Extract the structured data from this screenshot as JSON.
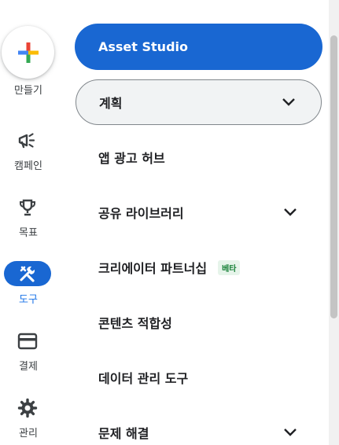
{
  "rail": {
    "create_label": "만들기",
    "items": [
      {
        "label": "캠페인",
        "icon": "megaphone-icon"
      },
      {
        "label": "목표",
        "icon": "trophy-icon"
      },
      {
        "label": "도구",
        "icon": "tools-icon",
        "active": true
      },
      {
        "label": "결제",
        "icon": "credit-card-icon"
      },
      {
        "label": "관리",
        "icon": "gear-icon"
      }
    ]
  },
  "menu": {
    "primary_label": "Asset Studio",
    "items": [
      {
        "label": "계획",
        "expandable": true
      },
      {
        "label": "앱 광고 허브"
      },
      {
        "label": "공유 라이브러리",
        "expandable": true
      },
      {
        "label": "크리에이터 파트너십",
        "badge": "베타"
      },
      {
        "label": "콘텐츠 적합성"
      },
      {
        "label": "데이터 관리 도구"
      },
      {
        "label": "문제 해결",
        "expandable": true
      }
    ]
  },
  "colors": {
    "accent": "#1967d2",
    "active_text": "#1a73e8",
    "badge_text": "#188038",
    "badge_bg": "#e6f4ea"
  }
}
